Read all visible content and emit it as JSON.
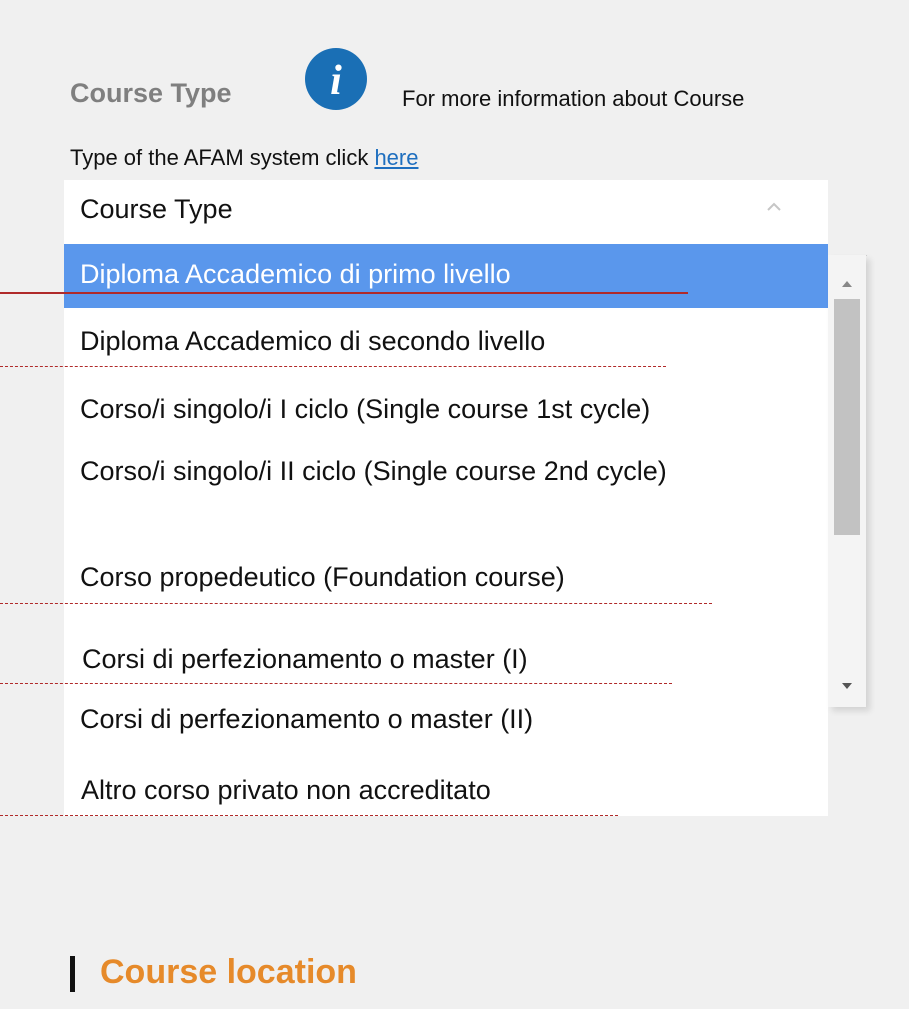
{
  "course_type": {
    "label": "Course Type",
    "info_text_line1": "For more information about Course",
    "info_text_line2_prefix": "Type of the AFAM system click ",
    "info_link": "here"
  },
  "select": {
    "value": "Course Type",
    "options": [
      "Diploma Accademico di primo livello",
      "Diploma Accademico di secondo livello",
      "Corso/i singolo/i I ciclo (Single course 1st cycle)",
      "Corso/i singolo/i II ciclo (Single course 2nd cycle)",
      "Corso propedeutico (Foundation course)",
      "Corsi di perfezionamento o master (I)",
      "Corsi di perfezionamento o master (II)",
      "Altro corso privato non accreditato"
    ],
    "selected_option": "Diploma Accademico di primo livello"
  },
  "section": {
    "title": "Course location"
  },
  "colors": {
    "highlight": "#5a97ec",
    "accent_orange": "#e68a2a",
    "label_gray": "#7f7f7f",
    "link_blue": "#1f6fbf",
    "annotation_red": "#b02a2a"
  }
}
